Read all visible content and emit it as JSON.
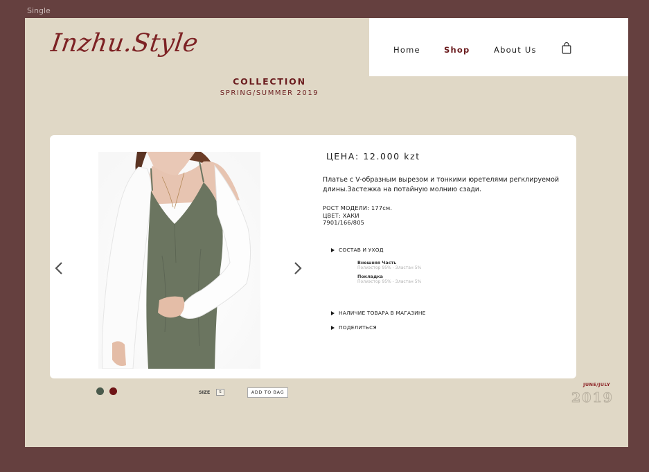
{
  "frame": {
    "label": "Single"
  },
  "brand": {
    "logo_text": "Inzhu.Style"
  },
  "nav": {
    "items": [
      {
        "label": "Home"
      },
      {
        "label": "Shop"
      },
      {
        "label": "About Us"
      }
    ],
    "active": "Shop",
    "cart_icon": "shopping-bag-icon"
  },
  "collection": {
    "title": "COLLECTION",
    "subtitle": "SPRING/SUMMER 2019"
  },
  "product": {
    "price": "ЦЕНА: 12.000 kzt",
    "description": "Платье с  V-образным вырезом и тонкими юретелями регклируемой длины.Застежка на потайную молнию сзади.",
    "specs": [
      "РОСТ МОДЕЛИ: 177см.",
      "ЦВЕТ: ХАКИ",
      "7901/166/805"
    ],
    "composition": {
      "label": "СОСТАВ И УХОД",
      "entries": [
        {
          "heading": "Внешняя Часть",
          "value": "Полиэстор 95% - Эластан 5%"
        },
        {
          "heading": "Покладка",
          "value": "Полиэстор 95% - Эластан 5%"
        }
      ]
    },
    "availability_label": "НАЛИЧИЕ ТОВАРА В МАГАЗИНЕ",
    "share_label": "ПОДЕЛИТЬСЯ",
    "photo_icon": "product-photo"
  },
  "carousel": {
    "prev_icon": "chevron-left-icon",
    "next_icon": "chevron-right-icon"
  },
  "options": {
    "colors": [
      "#4a5a4c",
      "#6e1416"
    ],
    "size_label": "SIZE",
    "size_value": "S",
    "add_to_bag_label": "ADD TO BAG"
  },
  "release": {
    "season": "JUNE/JULY",
    "year": "2019"
  },
  "theme": {
    "accent": "#6b1d1f",
    "background": "#e0d8c6",
    "outer": "#65403f"
  }
}
